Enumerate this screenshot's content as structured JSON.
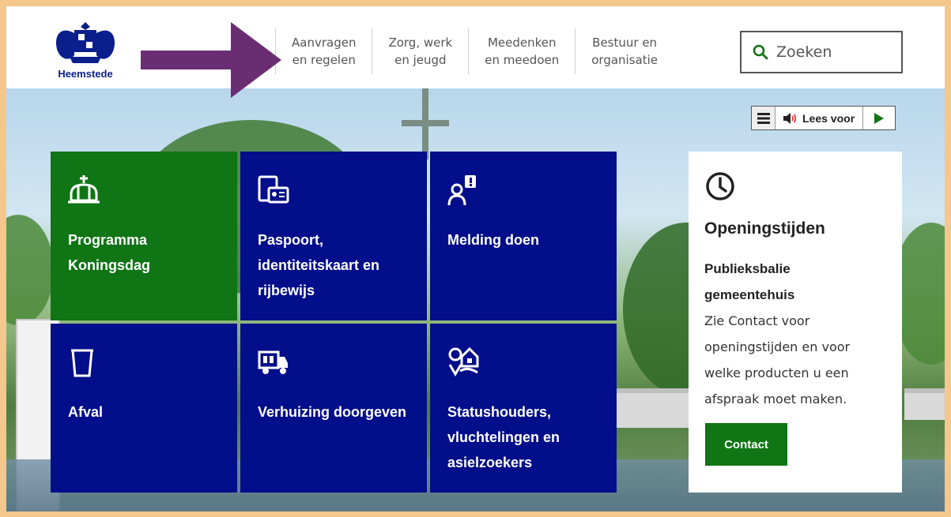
{
  "logo": {
    "name": "Heemstede"
  },
  "nav": [
    {
      "line1": "Aanvragen",
      "line2": "en regelen"
    },
    {
      "line1": "Zorg, werk",
      "line2": "en jeugd"
    },
    {
      "line1": "Meedenken",
      "line2": "en meedoen"
    },
    {
      "line1": "Bestuur en",
      "line2": "organisatie"
    }
  ],
  "search": {
    "label": "Zoeken"
  },
  "readspeaker": {
    "label": "Lees voor"
  },
  "tiles": [
    {
      "lines": [
        "Programma",
        "Koningsdag"
      ],
      "icon": "crown-icon",
      "color": "#107514"
    },
    {
      "lines": [
        "Paspoort,",
        "identiteitskaart en",
        "rijbewijs"
      ],
      "icon": "id-documents-icon",
      "color": "#020e8a"
    },
    {
      "lines": [
        "Melding doen"
      ],
      "icon": "report-person-icon",
      "color": "#020e8a"
    },
    {
      "lines": [
        "Afval"
      ],
      "icon": "waste-bin-icon",
      "color": "#020e8a"
    },
    {
      "lines": [
        "Verhuizing doorgeven"
      ],
      "icon": "moving-truck-icon",
      "color": "#020e8a"
    },
    {
      "lines": [
        "Statushouders,",
        "vluchtelingen en",
        "asielzoekers"
      ],
      "icon": "location-house-icon",
      "color": "#020e8a"
    }
  ],
  "hours": {
    "title": "Openingstijden",
    "subtitle_lines": [
      "Publieksbalie",
      "gemeentehuis"
    ],
    "text_lines": [
      "Zie Contact voor",
      "openingstijden en voor",
      "welke producten u een",
      "afspraak moet maken."
    ],
    "button": "Contact"
  },
  "colors": {
    "brand_blue": "#020e8a",
    "brand_green": "#107514",
    "arrow": "#6b2d72",
    "frame": "#f4c78d"
  }
}
